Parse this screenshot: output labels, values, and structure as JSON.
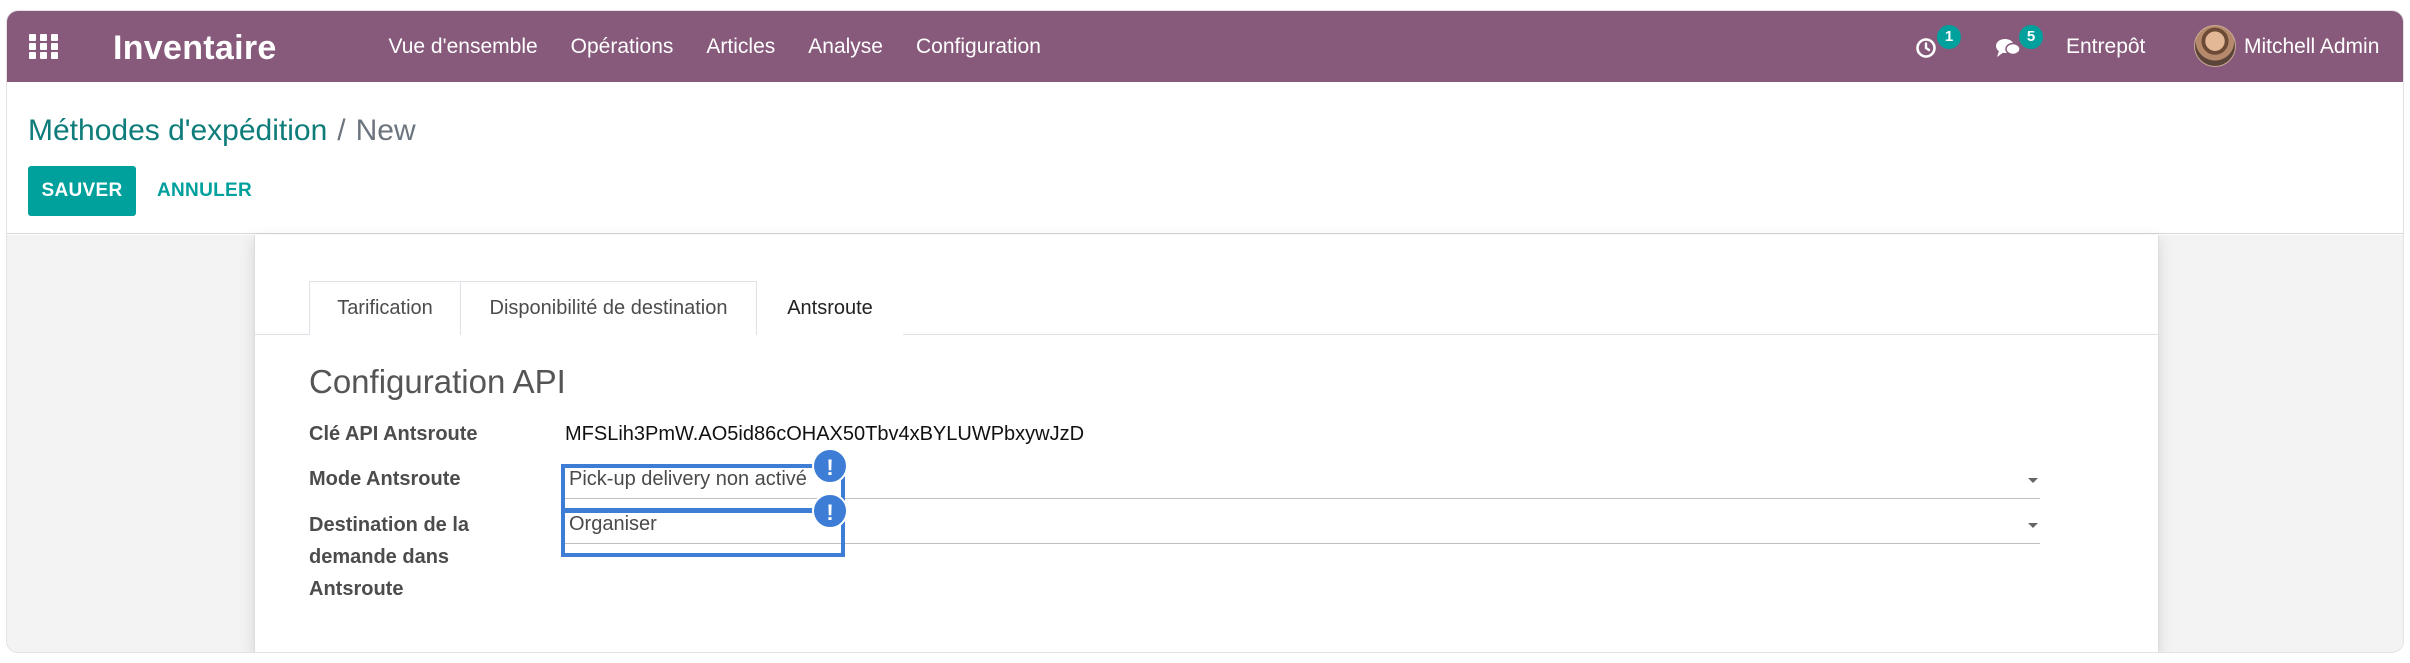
{
  "navbar": {
    "app_name": "Inventaire",
    "menu": [
      "Vue d'ensemble",
      "Opérations",
      "Articles",
      "Analyse",
      "Configuration"
    ],
    "activity_count": "1",
    "messages_count": "5",
    "company": "Entrepôt",
    "user": "Mitchell Admin",
    "colors": {
      "bar": "#875a7b",
      "badge": "#00a09d"
    }
  },
  "breadcrumb": {
    "parent": "Méthodes d'expédition",
    "separator": "/",
    "current": "New"
  },
  "buttons": {
    "save": "SAUVER",
    "discard": "ANNULER"
  },
  "tabs": [
    {
      "label": "Tarification",
      "active": false
    },
    {
      "label": "Disponibilité de destination",
      "active": false
    },
    {
      "label": "Antsroute",
      "active": true
    }
  ],
  "form": {
    "section_title": "Configuration API",
    "api_key": {
      "label": "Clé API Antsroute",
      "value": "MFSLih3PmW.AO5id86cOHAX50Tbv4xBYLUWPbxywJzD"
    },
    "mode": {
      "label": "Mode Antsroute",
      "value": "Pick-up delivery non activé"
    },
    "destination": {
      "label": "Destination de la demande dans Antsroute",
      "value": "Organiser"
    }
  },
  "annotations": {
    "marker_symbol": "!",
    "color": "#3e7dd6"
  }
}
